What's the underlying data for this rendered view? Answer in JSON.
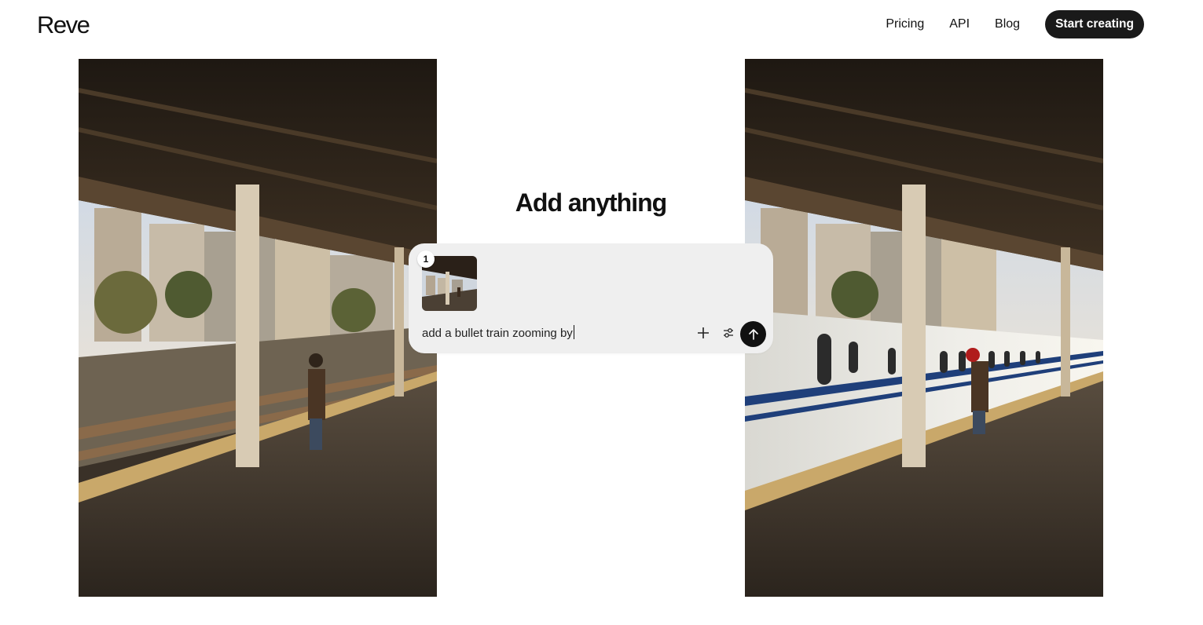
{
  "header": {
    "logo": "Reve",
    "nav": [
      {
        "label": "Pricing"
      },
      {
        "label": "API"
      },
      {
        "label": "Blog"
      }
    ],
    "cta_label": "Start creating"
  },
  "hero": {
    "headline": "Add anything",
    "prompt": {
      "attachment_badge": "1",
      "text": "add a bullet train zooming by"
    },
    "icons": {
      "plus": "plus-icon",
      "settings": "sliders-icon",
      "send": "arrow-up-icon"
    }
  },
  "colors": {
    "text": "#111111",
    "button_bg": "#1a1a1a",
    "card_bg": "#efefef",
    "train_stripe": "#1f3f7a"
  }
}
